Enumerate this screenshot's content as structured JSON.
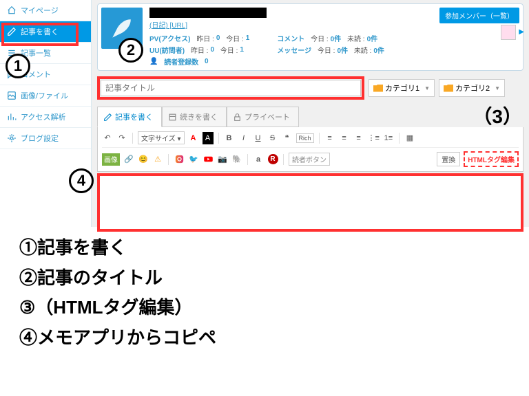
{
  "sidebar": {
    "items": [
      {
        "label": "マイページ",
        "icon": "home-icon"
      },
      {
        "label": "記事を書く",
        "icon": "edit-icon",
        "active": true
      },
      {
        "label": "記事一覧",
        "icon": "list-icon"
      },
      {
        "label": "コメント",
        "icon": "comment-icon"
      },
      {
        "label": "画像/ファイル",
        "icon": "image-icon"
      },
      {
        "label": "アクセス解析",
        "icon": "chart-icon"
      },
      {
        "label": "ブログ設定",
        "icon": "settings-icon"
      }
    ]
  },
  "header": {
    "url_label": "(日記) [URL]",
    "member_btn": "参加メンバー（一覧）",
    "stats_left": [
      {
        "label": "PV(アクセス)",
        "t1": "昨日 :",
        "v1": "0",
        "t2": "今日 :",
        "v2": "1"
      },
      {
        "label": "UU(訪問者)",
        "t1": "昨日 :",
        "v1": "0",
        "t2": "今日 :",
        "v2": "1"
      },
      {
        "label": "読者登録数",
        "v": "0"
      }
    ],
    "stats_right": [
      {
        "label": "コメント",
        "t1": "今日 :",
        "v1": "0件",
        "t2": "未読 :",
        "v2": "0件"
      },
      {
        "label": "メッセージ",
        "t1": "今日 :",
        "v1": "0件",
        "t2": "未読 :",
        "v2": "0件"
      }
    ]
  },
  "title_row": {
    "placeholder": "記事タイトル",
    "cat1": "カテゴリ1",
    "cat2": "カテゴリ2"
  },
  "tabs": [
    {
      "label": "記事を書く"
    },
    {
      "label": "続きを書く"
    },
    {
      "label": "プライベート"
    }
  ],
  "toolbar": {
    "font_size": "文字サイズ",
    "image": "画像",
    "reader_btn": "読者ボタン",
    "replace": "置換",
    "html_edit": "HTMLタグ編集"
  },
  "instructions": [
    "①記事を書く",
    "②記事のタイトル",
    "③（HTMLタグ編集）",
    "④メモアプリからコピペ"
  ],
  "annot": {
    "n3": "（3）"
  }
}
